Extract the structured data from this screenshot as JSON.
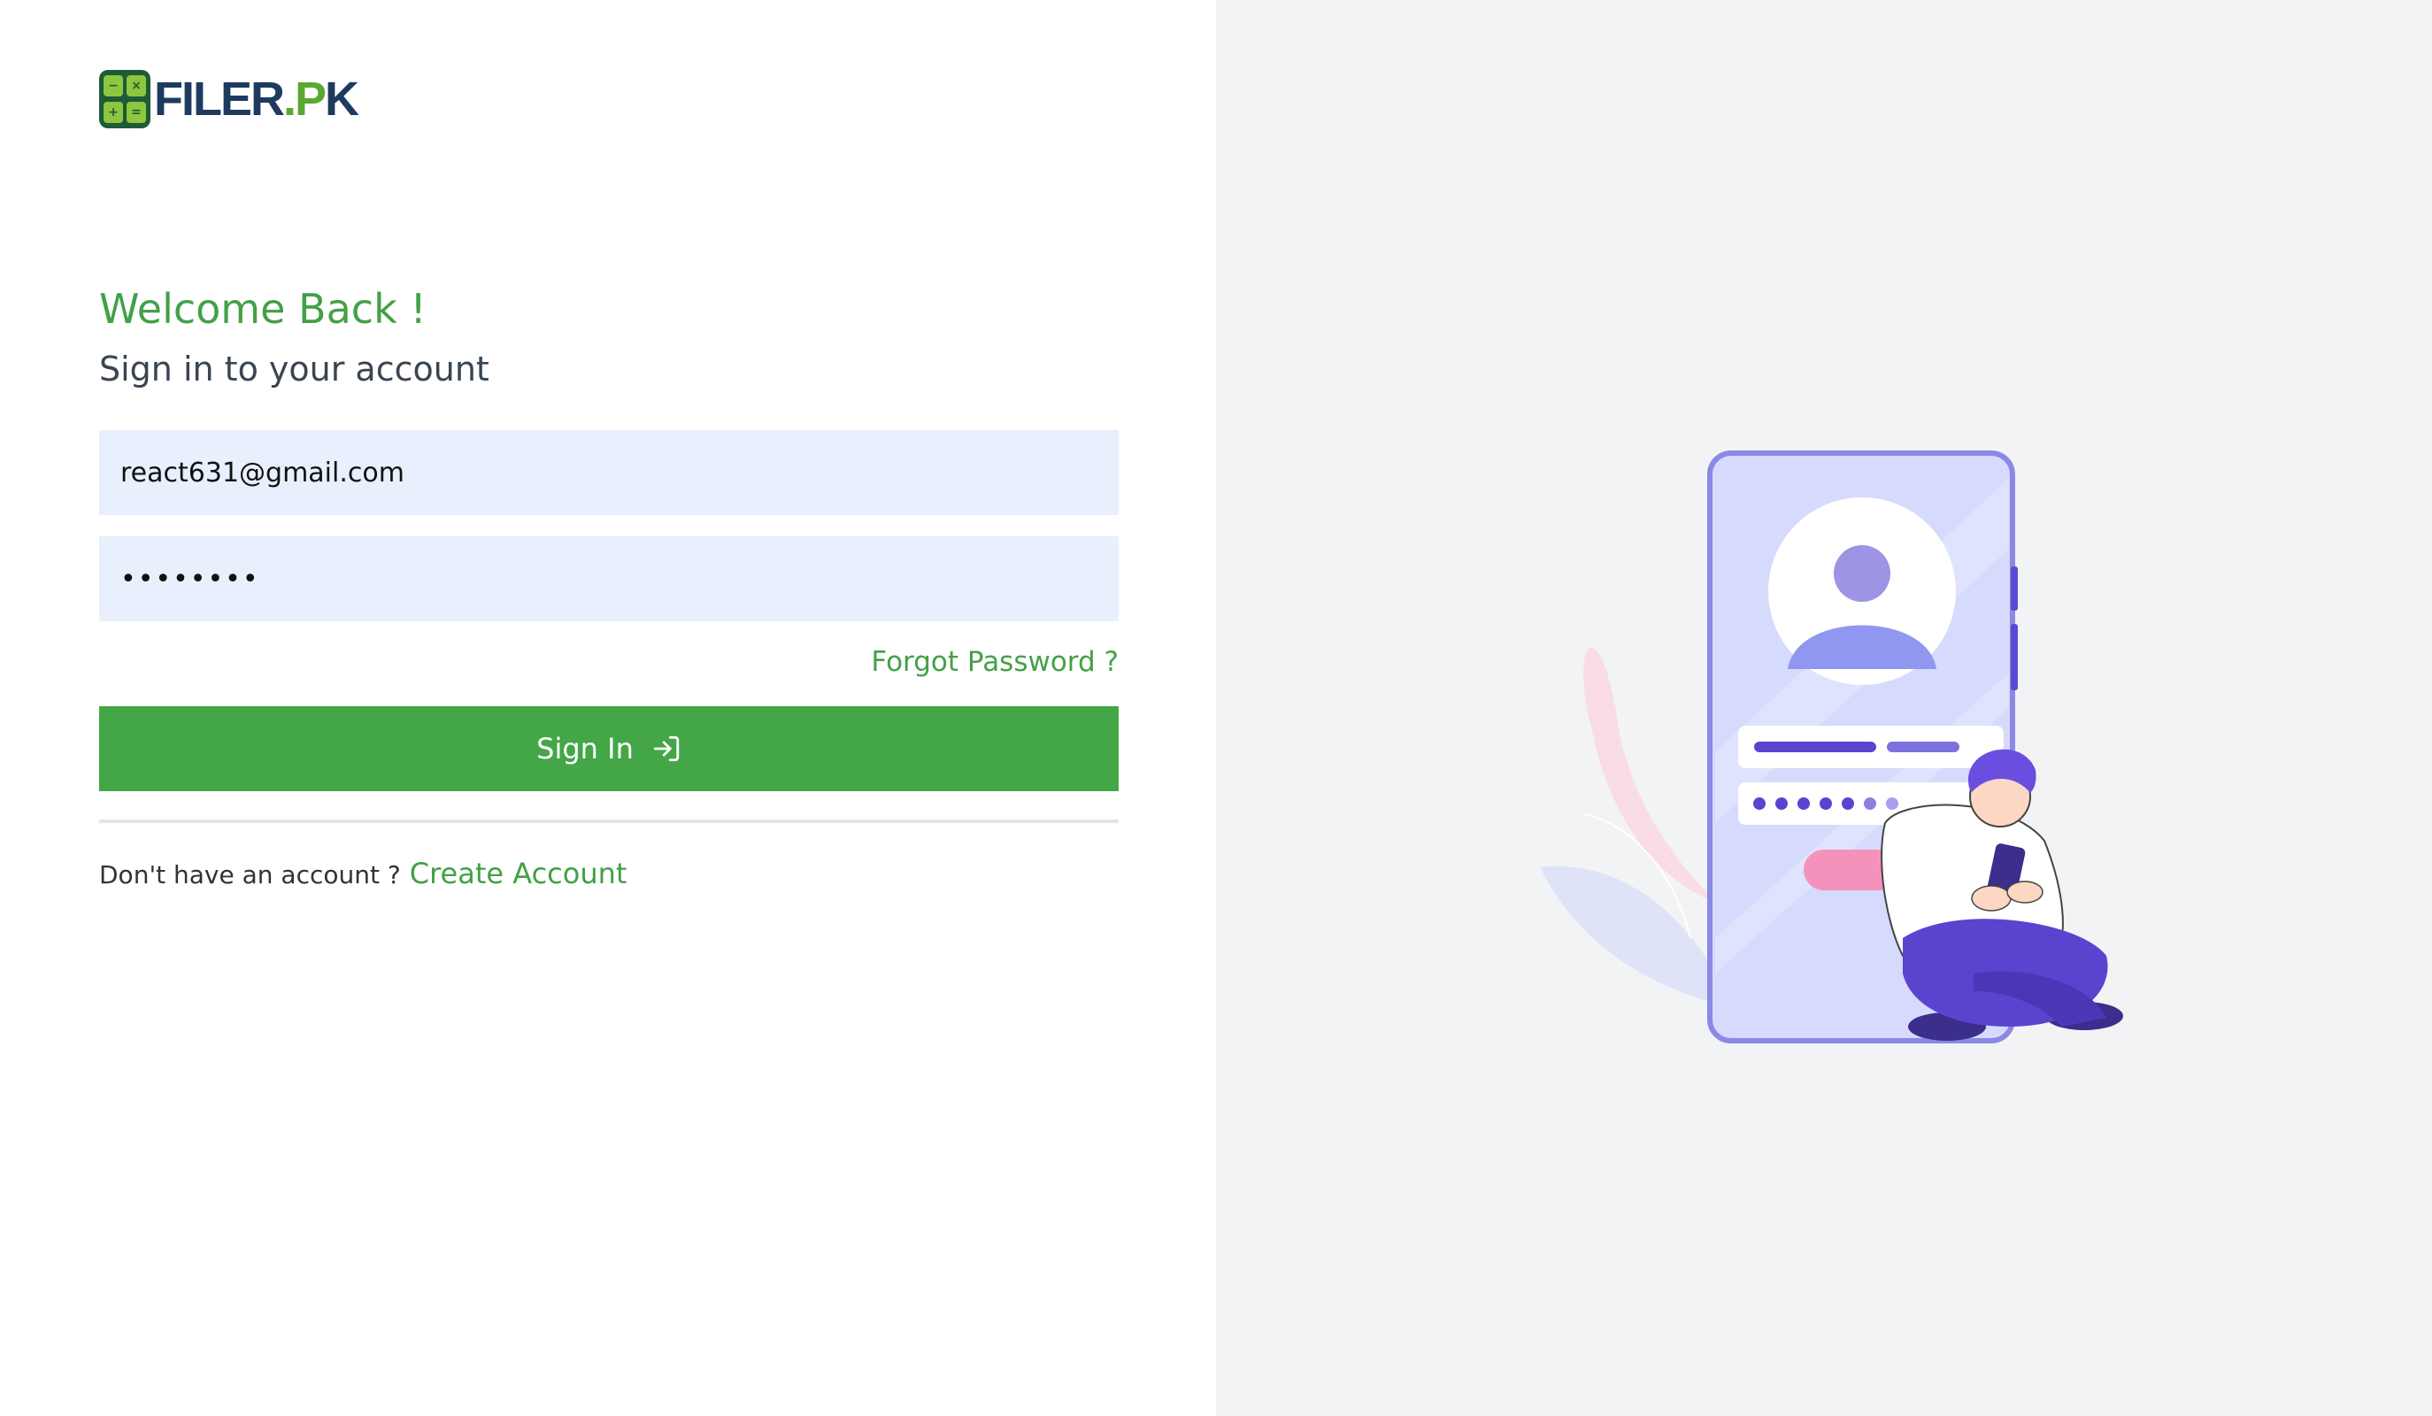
{
  "brand": {
    "logo_text_filer": "FILER",
    "logo_text_dot_p": ".P",
    "logo_text_k": "K",
    "colors": {
      "primary_green": "#43a647",
      "navy": "#1e3a5f",
      "lime": "#8dc63f"
    }
  },
  "form": {
    "heading": "Welcome Back !",
    "subheading": "Sign in to your account",
    "email_value": "react631@gmail.com",
    "password_value": "••••••••",
    "forgot_link": "Forgot Password ?",
    "signin_label": "Sign In",
    "no_account_text": "Don't have an account ?",
    "create_account_link": "Create Account"
  },
  "icons": {
    "signin": "login-arrow-icon",
    "illustration": "person-with-phone-illustration"
  }
}
